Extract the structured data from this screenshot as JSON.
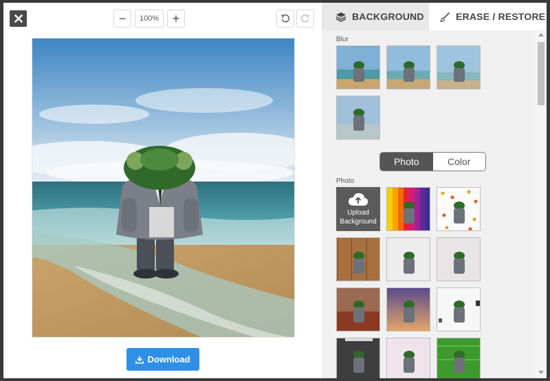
{
  "toolbar": {
    "zoom_value": "100%",
    "zoom_out_symbol": "−",
    "zoom_in_symbol": "+",
    "close_icon": "close-icon",
    "undo_icon": "undo-icon",
    "redo_icon": "redo-icon"
  },
  "download": {
    "label": "Download",
    "icon": "download-icon"
  },
  "tabs": [
    {
      "label": "BACKGROUND",
      "icon": "layers-icon",
      "active": true
    },
    {
      "label": "ERASE / RESTORE",
      "icon": "brush-icon",
      "active": false
    }
  ],
  "sections": {
    "blur_label": "Blur",
    "photo_label": "Photo"
  },
  "toggle": {
    "options": [
      "Photo",
      "Color"
    ],
    "selected": "Photo"
  },
  "upload": {
    "line1": "Upload",
    "line2": "Background",
    "icon": "cloud-upload-icon"
  },
  "colors": {
    "accent": "#2f8fe6",
    "dark": "#555555",
    "panel": "#f0f0f0"
  }
}
